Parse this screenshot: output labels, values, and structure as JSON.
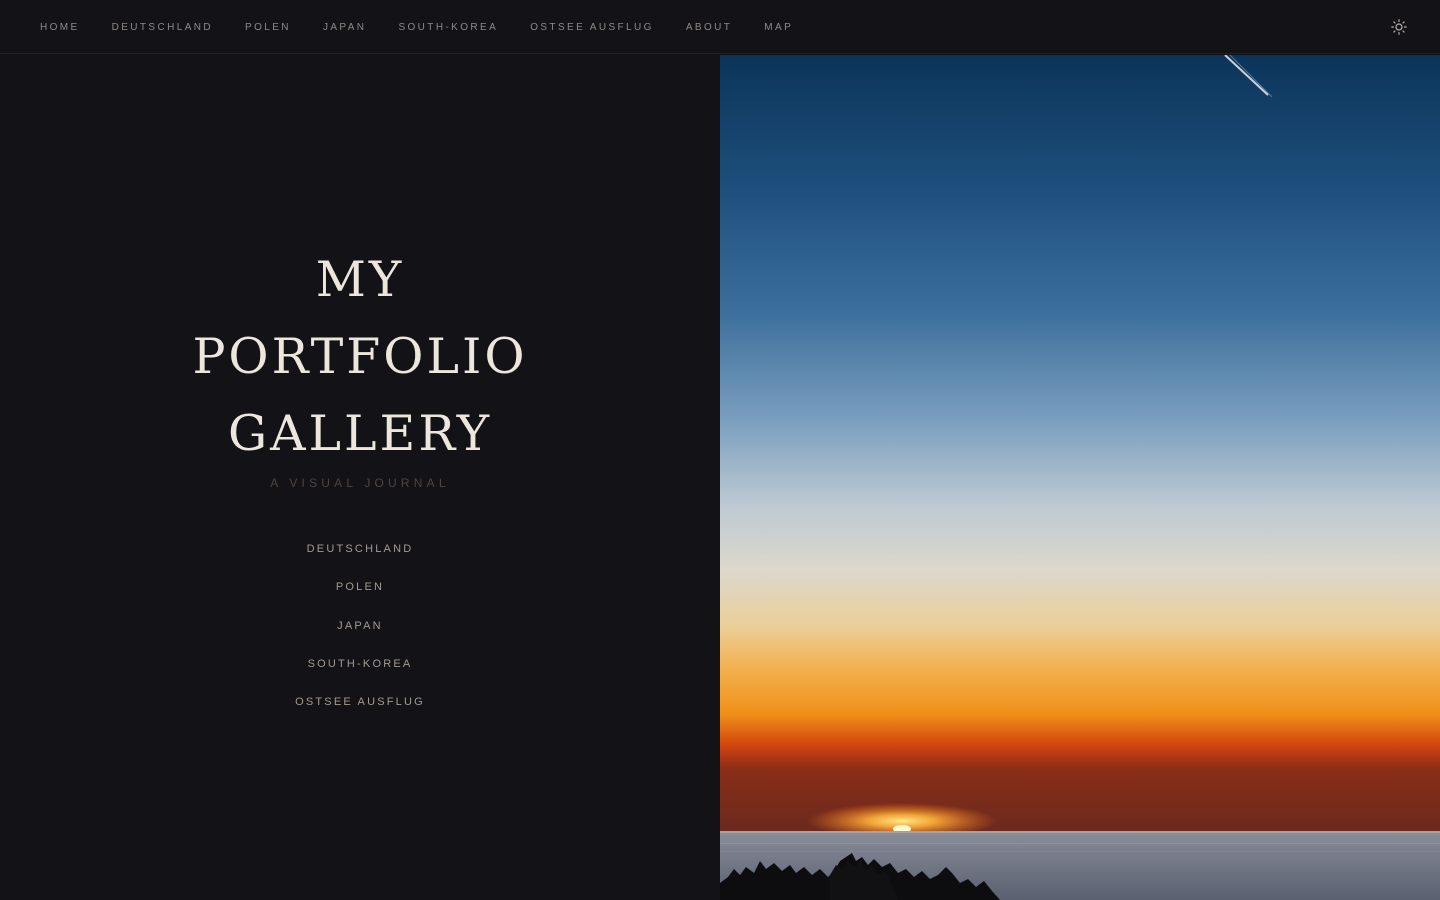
{
  "nav": {
    "items": [
      {
        "label": "HOME"
      },
      {
        "label": "DEUTSCHLAND"
      },
      {
        "label": "POLEN"
      },
      {
        "label": "JAPAN"
      },
      {
        "label": "SOUTH-KOREA"
      },
      {
        "label": "OSTSEE AUSFLUG"
      },
      {
        "label": "ABOUT"
      },
      {
        "label": "MAP"
      }
    ],
    "theme_toggle_icon": "sun-icon"
  },
  "hero": {
    "title_lines": [
      "MY",
      "PORTFOLIO",
      "GALLERY"
    ],
    "subtitle": "A VISUAL JOURNAL",
    "gallery_links": [
      {
        "label": "DEUTSCHLAND"
      },
      {
        "label": "POLEN"
      },
      {
        "label": "JAPAN"
      },
      {
        "label": "SOUTH-KOREA"
      },
      {
        "label": "OSTSEE AUSFLUG"
      }
    ]
  },
  "colors": {
    "background": "#131217",
    "title": "#ece6dc",
    "nav_text": "#8f8a84",
    "subtitle": "#4f443f",
    "link_text": "#a39a92"
  }
}
